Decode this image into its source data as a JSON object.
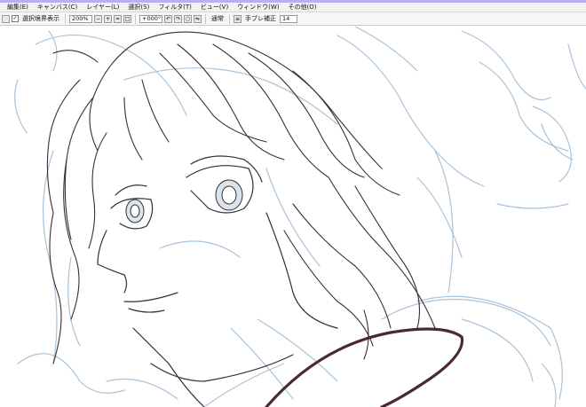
{
  "menu": {
    "items": [
      "編集(E)",
      "キャンバス(C)",
      "レイヤー(L)",
      "選択(S)",
      "フィルタ(T)",
      "ビュー(V)",
      "ウィンドウ(W)",
      "その他(O)"
    ]
  },
  "toolbar": {
    "show_selection_label": "選択境界表示",
    "show_selection_checked": true,
    "zoom_value": "200%",
    "rotation_value": "+000°",
    "blend_label": "通常",
    "stabilizer_label": "手ブレ補正",
    "stabilizer_value": "14"
  },
  "colors": {
    "sketch_blue": "#a9c3da",
    "lineart_dark": "#3a2e30",
    "lineart_brown": "#4a2a2c",
    "menubar_bg": "#f2f2f2",
    "accent_top": "#b7b0f0"
  }
}
